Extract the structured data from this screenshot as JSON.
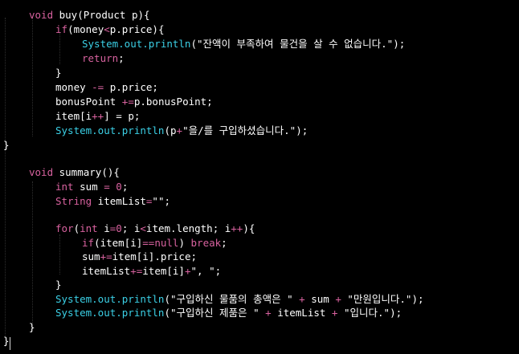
{
  "editor": {
    "background": "#000000",
    "colors": {
      "keyword": "#d8629f",
      "function": "#3bd0e6",
      "string": "#ffffff",
      "number": "#d8629f",
      "plain": "#ffffff"
    },
    "lines": [
      {
        "tokens": [
          [
            "kw",
            "void"
          ],
          [
            "p",
            " buy(Product p){"
          ]
        ]
      },
      {
        "tokens": [
          [
            "kw",
            "if"
          ],
          [
            "p",
            "(money"
          ],
          [
            "op",
            "<"
          ],
          [
            "p",
            "p.price){"
          ]
        ]
      },
      {
        "tokens": [
          [
            "fn",
            "System.out.println"
          ],
          [
            "p",
            "("
          ],
          [
            "s",
            "\"잔액이 부족하여 물건을 살 수 없습니다.\""
          ],
          [
            "p",
            ");"
          ]
        ]
      },
      {
        "tokens": [
          [
            "kw",
            "return"
          ],
          [
            "p",
            ";"
          ]
        ]
      },
      {
        "tokens": [
          [
            "p",
            "}"
          ]
        ]
      },
      {
        "tokens": [
          [
            "p",
            "money "
          ],
          [
            "op",
            "-="
          ],
          [
            "p",
            " p.price;"
          ]
        ]
      },
      {
        "tokens": [
          [
            "p",
            "bonusPoint "
          ],
          [
            "op",
            "+="
          ],
          [
            "p",
            "p.bonusPoint;"
          ]
        ]
      },
      {
        "tokens": [
          [
            "p",
            "item[i"
          ],
          [
            "op",
            "++"
          ],
          [
            "p",
            "] = p;"
          ]
        ]
      },
      {
        "tokens": [
          [
            "fn",
            "System.out.println"
          ],
          [
            "p",
            "(p"
          ],
          [
            "op",
            "+"
          ],
          [
            "s",
            "\"을/를 구입하셨습니다.\""
          ],
          [
            "p",
            ");"
          ]
        ]
      },
      {
        "tokens": [
          [
            "p",
            "}"
          ]
        ]
      },
      {
        "tokens": []
      },
      {
        "tokens": [
          [
            "kw",
            "void"
          ],
          [
            "p",
            " summary(){"
          ]
        ]
      },
      {
        "tokens": [
          [
            "kw",
            "int"
          ],
          [
            "p",
            " sum "
          ],
          [
            "op",
            "="
          ],
          [
            "num",
            " 0"
          ],
          [
            "p",
            ";"
          ]
        ]
      },
      {
        "tokens": [
          [
            "kw",
            "String"
          ],
          [
            "p",
            " itemList"
          ],
          [
            "op",
            "="
          ],
          [
            "s",
            "\"\""
          ],
          [
            "p",
            ";"
          ]
        ]
      },
      {
        "tokens": []
      },
      {
        "tokens": [
          [
            "kw",
            "for"
          ],
          [
            "p",
            "("
          ],
          [
            "kw",
            "int"
          ],
          [
            "p",
            " i"
          ],
          [
            "op",
            "="
          ],
          [
            "num",
            "0"
          ],
          [
            "p",
            "; i"
          ],
          [
            "op",
            "<"
          ],
          [
            "p",
            "item.length; i"
          ],
          [
            "op",
            "++"
          ],
          [
            "p",
            "){"
          ]
        ]
      },
      {
        "tokens": [
          [
            "kw",
            "if"
          ],
          [
            "p",
            "(item[i]"
          ],
          [
            "op",
            "=="
          ],
          [
            "kw",
            "null"
          ],
          [
            "p",
            ") "
          ],
          [
            "kw",
            "break"
          ],
          [
            "p",
            ";"
          ]
        ]
      },
      {
        "tokens": [
          [
            "p",
            "sum"
          ],
          [
            "op",
            "+="
          ],
          [
            "p",
            "item[i].price;"
          ]
        ]
      },
      {
        "tokens": [
          [
            "p",
            "itemList"
          ],
          [
            "op",
            "+="
          ],
          [
            "p",
            "item[i]"
          ],
          [
            "op",
            "+"
          ],
          [
            "s",
            "\", \""
          ],
          [
            "p",
            ";"
          ]
        ]
      },
      {
        "tokens": [
          [
            "p",
            "}"
          ]
        ]
      },
      {
        "tokens": [
          [
            "fn",
            "System.out.println"
          ],
          [
            "p",
            "("
          ],
          [
            "s",
            "\"구입하신 물품의 총액은 \""
          ],
          [
            "op",
            " + "
          ],
          [
            "p",
            "sum"
          ],
          [
            "op",
            " + "
          ],
          [
            "s",
            "\"만원입니다.\""
          ],
          [
            "p",
            ");"
          ]
        ]
      },
      {
        "tokens": [
          [
            "fn",
            "System.out.println"
          ],
          [
            "p",
            "("
          ],
          [
            "s",
            "\"구입하신 제품은 \""
          ],
          [
            "op",
            " + "
          ],
          [
            "p",
            "itemList"
          ],
          [
            "op",
            " + "
          ],
          [
            "s",
            "\"입니다.\""
          ],
          [
            "p",
            ");"
          ]
        ]
      },
      {
        "tokens": [
          [
            "p",
            "}"
          ]
        ]
      },
      {
        "tokens": [
          [
            "p",
            "}"
          ]
        ]
      }
    ]
  }
}
